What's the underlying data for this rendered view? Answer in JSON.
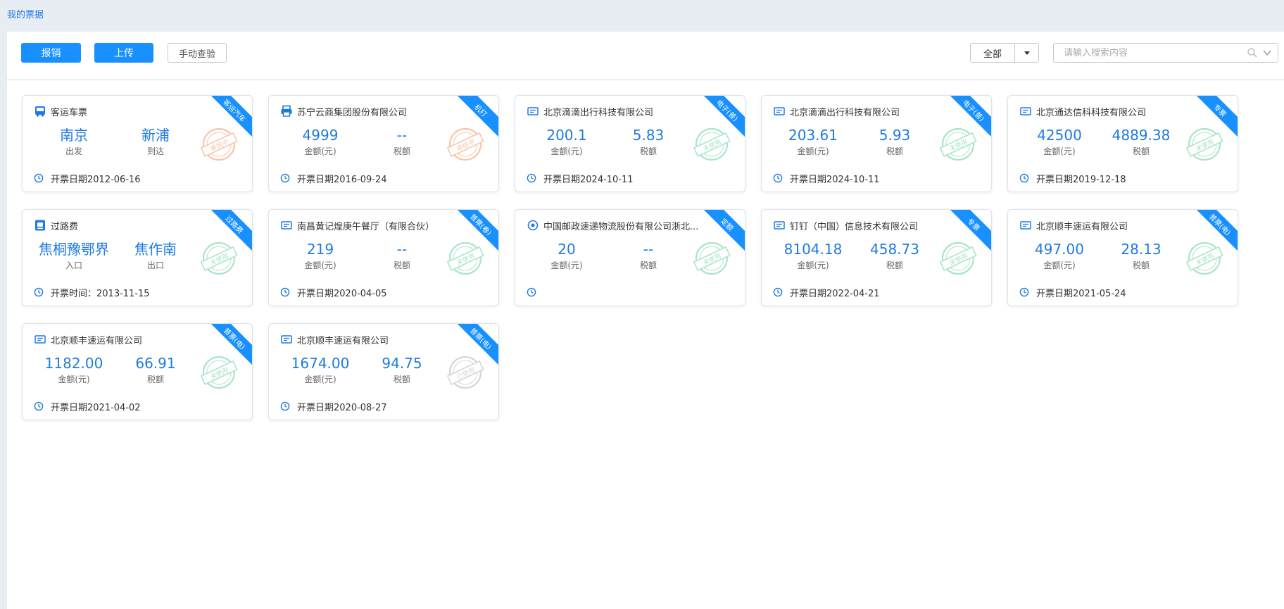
{
  "breadcrumb": "我的票据",
  "toolbar": {
    "reimburse_label": "报销",
    "upload_label": "上传",
    "manual_check_label": "手动查验",
    "filter_value": "全部",
    "search_placeholder": "请输入搜索内容"
  },
  "colors": {
    "primary": "#1890ff",
    "value_text": "#1f7ae0",
    "stamp_orange": "#f5b38f",
    "stamp_green": "#8fdcb8",
    "stamp_gray": "#c8c8c8"
  },
  "cards": [
    {
      "icon": "bus-icon",
      "title": "客运车票",
      "ribbon": "客运汽车",
      "a_value": "南京",
      "a_label": "出发",
      "b_value": "新浦",
      "b_label": "到达",
      "stamp": "审核中",
      "stamp_color": "orange",
      "date": "开票日期2012-06-16"
    },
    {
      "icon": "printer-icon",
      "title": "苏宁云商集团股份有限公司",
      "ribbon": "机打",
      "a_value": "4999",
      "a_label": "金额(元)",
      "b_value": "--",
      "b_label": "税额",
      "stamp": "审核中",
      "stamp_color": "orange",
      "date": "开票日期2016-09-24"
    },
    {
      "icon": "invoice-icon",
      "title": "北京滴滴出行科技有限公司",
      "ribbon": "电子(普)",
      "a_value": "200.1",
      "a_label": "金额(元)",
      "b_value": "5.83",
      "b_label": "税额",
      "stamp": "未使用",
      "stamp_color": "green",
      "date": "开票日期2024-10-11"
    },
    {
      "icon": "invoice-icon",
      "title": "北京滴滴出行科技有限公司",
      "ribbon": "电子(普)",
      "a_value": "203.61",
      "a_label": "金额(元)",
      "b_value": "5.93",
      "b_label": "税额",
      "stamp": "未使用",
      "stamp_color": "green",
      "date": "开票日期2024-10-11"
    },
    {
      "icon": "invoice-icon",
      "title": "北京通达信科科技有限公司",
      "ribbon": "专票",
      "a_value": "42500",
      "a_label": "金额(元)",
      "b_value": "4889.38",
      "b_label": "税额",
      "stamp": "未使用",
      "stamp_color": "green",
      "date": "开票日期2019-12-18"
    },
    {
      "icon": "toll-icon",
      "title": "过路费",
      "ribbon": "过路费",
      "a_value": "焦桐豫鄂界",
      "a_label": "入口",
      "b_value": "焦作南",
      "b_label": "出口",
      "stamp": "未使用",
      "stamp_color": "green",
      "date": "开票时间：2013-11-15"
    },
    {
      "icon": "invoice-icon",
      "title": "南昌黄记煌庚午餐厅（有限合伙）",
      "ribbon": "普票(卷)",
      "a_value": "219",
      "a_label": "金额(元)",
      "b_value": "--",
      "b_label": "税额",
      "stamp": "未使用",
      "stamp_color": "green",
      "date": "开票日期2020-04-05"
    },
    {
      "icon": "fixed-invoice-icon",
      "title": "中国邮政速递物流股份有限公司浙北...",
      "ribbon": "定额",
      "a_value": "20",
      "a_label": "金额(元)",
      "b_value": "--",
      "b_label": "税额",
      "stamp": "未使用",
      "stamp_color": "green",
      "date": ""
    },
    {
      "icon": "invoice-icon",
      "title": "钉钉（中国）信息技术有限公司",
      "ribbon": "专票",
      "a_value": "8104.18",
      "a_label": "金额(元)",
      "b_value": "458.73",
      "b_label": "税额",
      "stamp": "未使用",
      "stamp_color": "green",
      "date": "开票日期2022-04-21"
    },
    {
      "icon": "invoice-icon",
      "title": "北京顺丰速运有限公司",
      "ribbon": "普票(电)",
      "a_value": "497.00",
      "a_label": "金额(元)",
      "b_value": "28.13",
      "b_label": "税额",
      "stamp": "未使用",
      "stamp_color": "green",
      "date": "开票日期2021-05-24"
    },
    {
      "icon": "invoice-icon",
      "title": "北京顺丰速运有限公司",
      "ribbon": "普票(电)",
      "a_value": "1182.00",
      "a_label": "金额(元)",
      "b_value": "66.91",
      "b_label": "税额",
      "stamp": "未使用",
      "stamp_color": "green",
      "date": "开票日期2021-04-02"
    },
    {
      "icon": "invoice-icon",
      "title": "北京顺丰速运有限公司",
      "ribbon": "普票(电)",
      "a_value": "1674.00",
      "a_label": "金额(元)",
      "b_value": "94.75",
      "b_label": "税额",
      "stamp": "已使用",
      "stamp_color": "gray",
      "date": "开票日期2020-08-27"
    }
  ]
}
